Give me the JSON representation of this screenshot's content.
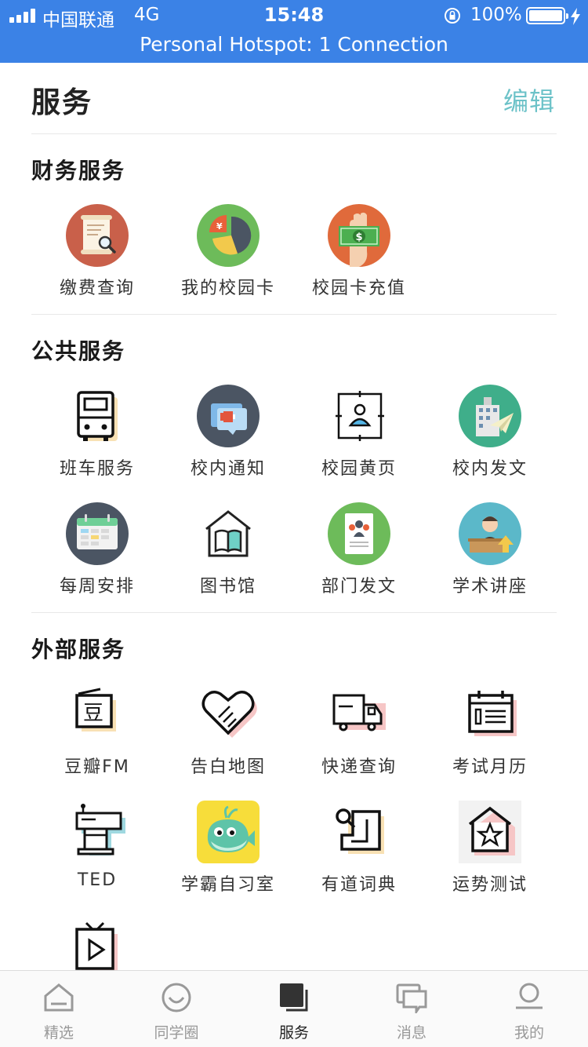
{
  "status_bar": {
    "carrier": "中国联通",
    "network": "4G",
    "time": "15:48",
    "battery": "100%",
    "battery_level": 1.0,
    "signal_bars": 4,
    "hotspot_banner": "Personal Hotspot: 1 Connection"
  },
  "header": {
    "title": "服务",
    "edit_label": "编辑"
  },
  "sections": [
    {
      "title": "财务服务",
      "items": [
        {
          "label": "缴费查询",
          "icon": "receipt-search-icon"
        },
        {
          "label": "我的校园卡",
          "icon": "pie-chart-icon"
        },
        {
          "label": "校园卡充值",
          "icon": "cash-hand-icon"
        }
      ]
    },
    {
      "title": "公共服务",
      "items": [
        {
          "label": "班车服务",
          "icon": "bus-icon"
        },
        {
          "label": "校内通知",
          "icon": "notification-icon"
        },
        {
          "label": "校园黄页",
          "icon": "contact-icon"
        },
        {
          "label": "校内发文",
          "icon": "building-plane-icon"
        },
        {
          "label": "每周安排",
          "icon": "calendar-icon"
        },
        {
          "label": "图书馆",
          "icon": "library-icon"
        },
        {
          "label": "部门发文",
          "icon": "department-doc-icon"
        },
        {
          "label": "学术讲座",
          "icon": "lecture-icon"
        }
      ]
    },
    {
      "title": "外部服务",
      "items": [
        {
          "label": "豆瓣FM",
          "icon": "douban-radio-icon"
        },
        {
          "label": "告白地图",
          "icon": "heart-icon"
        },
        {
          "label": "快递查询",
          "icon": "truck-icon"
        },
        {
          "label": "考试月历",
          "icon": "exam-calendar-icon"
        },
        {
          "label": "TED",
          "icon": "podium-icon"
        },
        {
          "label": "学霸自习室",
          "icon": "whale-icon"
        },
        {
          "label": "有道词典",
          "icon": "puzzle-icon"
        },
        {
          "label": "运势测试",
          "icon": "house-star-icon"
        },
        {
          "label": "",
          "icon": "tv-play-icon"
        }
      ]
    }
  ],
  "tabs": [
    {
      "label": "精选",
      "icon": "home-icon",
      "active": false
    },
    {
      "label": "同学圈",
      "icon": "smile-icon",
      "active": false
    },
    {
      "label": "服务",
      "icon": "service-icon",
      "active": true
    },
    {
      "label": "消息",
      "icon": "message-icon",
      "active": false
    },
    {
      "label": "我的",
      "icon": "profile-icon",
      "active": false
    }
  ],
  "colors": {
    "status_bar": "#3b82e6",
    "edit_accent": "#6cc2c8",
    "tab_active": "#222222",
    "tab_inactive": "#999999"
  }
}
